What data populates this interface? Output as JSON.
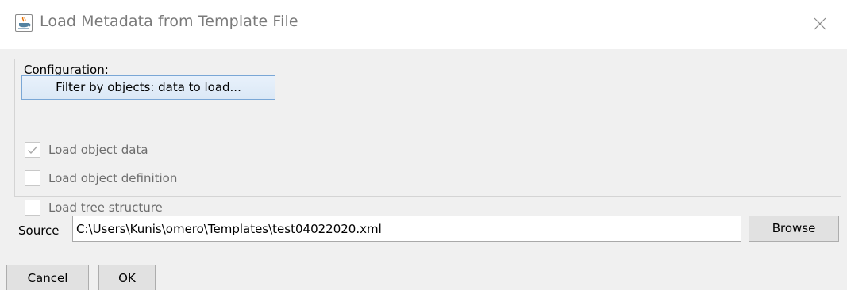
{
  "window": {
    "title": "Load Metadata from Template File",
    "icon": "java-cup-icon",
    "close_icon": "close-icon"
  },
  "configuration": {
    "legend": "Configuration:",
    "filter_button_label": "Filter by objects: data to load...",
    "options": [
      {
        "label": "Load object data",
        "checked": true,
        "enabled": false
      },
      {
        "label": "Load object definition",
        "checked": false,
        "enabled": false
      },
      {
        "label": "Load tree structure",
        "checked": false,
        "enabled": false
      }
    ]
  },
  "source": {
    "label": "Source",
    "value": "C:\\Users\\Kunis\\omero\\Templates\\test04022020.xml",
    "browse_label": "Browse"
  },
  "actions": {
    "cancel_label": "Cancel",
    "ok_label": "OK"
  },
  "colors": {
    "dialog_bg": "#f0f0f0",
    "title_text": "#7a7a7a",
    "focus_border": "#7aa7d6",
    "disabled_text": "#6d6d6d"
  }
}
